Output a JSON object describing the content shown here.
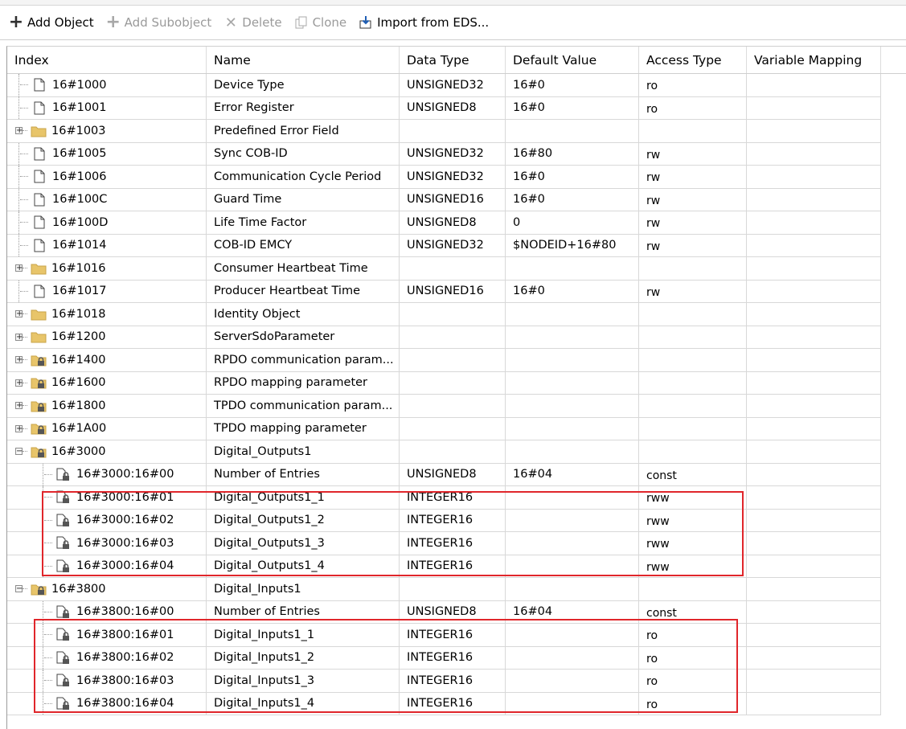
{
  "toolbar": {
    "add_object": "Add Object",
    "add_subobject": "Add Subobject",
    "delete": "Delete",
    "clone": "Clone",
    "import_eds": "Import from EDS..."
  },
  "columns": {
    "index": "Index",
    "name": "Name",
    "data_type": "Data Type",
    "default_value": "Default Value",
    "access_type": "Access Type",
    "variable_mapping": "Variable Mapping"
  },
  "rows": [
    {
      "index": "16#1000",
      "name": "Device Type",
      "type": "UNSIGNED32",
      "def": "16#0",
      "acc": "ro",
      "icon": "file-icon",
      "level": 0,
      "exp": ""
    },
    {
      "index": "16#1001",
      "name": "Error Register",
      "type": "UNSIGNED8",
      "def": "16#0",
      "acc": "ro",
      "icon": "file-icon",
      "level": 0,
      "exp": ""
    },
    {
      "index": "16#1003",
      "name": "Predefined Error Field",
      "type": "",
      "def": "",
      "acc": "",
      "icon": "folder-icon",
      "level": 0,
      "exp": "+"
    },
    {
      "index": "16#1005",
      "name": "Sync COB-ID",
      "type": "UNSIGNED32",
      "def": "16#80",
      "acc": "rw",
      "icon": "file-icon",
      "level": 0,
      "exp": ""
    },
    {
      "index": "16#1006",
      "name": "Communication Cycle Period",
      "type": "UNSIGNED32",
      "def": "16#0",
      "acc": "rw",
      "icon": "file-icon",
      "level": 0,
      "exp": ""
    },
    {
      "index": "16#100C",
      "name": "Guard Time",
      "type": "UNSIGNED16",
      "def": "16#0",
      "acc": "rw",
      "icon": "file-icon",
      "level": 0,
      "exp": ""
    },
    {
      "index": "16#100D",
      "name": "Life Time Factor",
      "type": "UNSIGNED8",
      "def": "0",
      "acc": "rw",
      "icon": "file-icon",
      "level": 0,
      "exp": ""
    },
    {
      "index": "16#1014",
      "name": "COB-ID EMCY",
      "type": "UNSIGNED32",
      "def": "$NODEID+16#80",
      "acc": "rw",
      "icon": "file-icon",
      "level": 0,
      "exp": ""
    },
    {
      "index": "16#1016",
      "name": "Consumer Heartbeat Time",
      "type": "",
      "def": "",
      "acc": "",
      "icon": "folder-icon",
      "level": 0,
      "exp": "+"
    },
    {
      "index": "16#1017",
      "name": "Producer Heartbeat Time",
      "type": "UNSIGNED16",
      "def": "16#0",
      "acc": "rw",
      "icon": "file-icon",
      "level": 0,
      "exp": ""
    },
    {
      "index": "16#1018",
      "name": "Identity Object",
      "type": "",
      "def": "",
      "acc": "",
      "icon": "folder-icon",
      "level": 0,
      "exp": "+"
    },
    {
      "index": "16#1200",
      "name": "ServerSdoParameter",
      "type": "",
      "def": "",
      "acc": "",
      "icon": "folder-icon",
      "level": 0,
      "exp": "+"
    },
    {
      "index": "16#1400",
      "name": "RPDO communication param...",
      "type": "",
      "def": "",
      "acc": "",
      "icon": "locked-folder-icon",
      "level": 0,
      "exp": "+"
    },
    {
      "index": "16#1600",
      "name": "RPDO mapping parameter",
      "type": "",
      "def": "",
      "acc": "",
      "icon": "locked-folder-icon",
      "level": 0,
      "exp": "+"
    },
    {
      "index": "16#1800",
      "name": "TPDO communication param...",
      "type": "",
      "def": "",
      "acc": "",
      "icon": "locked-folder-icon",
      "level": 0,
      "exp": "+"
    },
    {
      "index": "16#1A00",
      "name": "TPDO mapping parameter",
      "type": "",
      "def": "",
      "acc": "",
      "icon": "locked-folder-icon",
      "level": 0,
      "exp": "+"
    },
    {
      "index": "16#3000",
      "name": "Digital_Outputs1",
      "type": "",
      "def": "",
      "acc": "",
      "icon": "locked-folder-icon",
      "level": 0,
      "exp": "-"
    },
    {
      "index": "16#3000:16#00",
      "name": "Number of Entries",
      "type": "UNSIGNED8",
      "def": "16#04",
      "acc": "const",
      "icon": "locked-file-icon",
      "level": 1,
      "exp": ""
    },
    {
      "index": "16#3000:16#01",
      "name": "Digital_Outputs1_1",
      "type": "INTEGER16",
      "def": "",
      "acc": "rww",
      "icon": "locked-file-icon",
      "level": 1,
      "exp": ""
    },
    {
      "index": "16#3000:16#02",
      "name": "Digital_Outputs1_2",
      "type": "INTEGER16",
      "def": "",
      "acc": "rww",
      "icon": "locked-file-icon",
      "level": 1,
      "exp": ""
    },
    {
      "index": "16#3000:16#03",
      "name": "Digital_Outputs1_3",
      "type": "INTEGER16",
      "def": "",
      "acc": "rww",
      "icon": "locked-file-icon",
      "level": 1,
      "exp": ""
    },
    {
      "index": "16#3000:16#04",
      "name": "Digital_Outputs1_4",
      "type": "INTEGER16",
      "def": "",
      "acc": "rww",
      "icon": "locked-file-icon",
      "level": 1,
      "exp": ""
    },
    {
      "index": "16#3800",
      "name": "Digital_Inputs1",
      "type": "",
      "def": "",
      "acc": "",
      "icon": "locked-folder-icon",
      "level": 0,
      "exp": "-"
    },
    {
      "index": "16#3800:16#00",
      "name": "Number of Entries",
      "type": "UNSIGNED8",
      "def": "16#04",
      "acc": "const",
      "icon": "locked-file-icon",
      "level": 1,
      "exp": ""
    },
    {
      "index": "16#3800:16#01",
      "name": "Digital_Inputs1_1",
      "type": "INTEGER16",
      "def": "",
      "acc": "ro",
      "icon": "locked-file-icon",
      "level": 1,
      "exp": ""
    },
    {
      "index": "16#3800:16#02",
      "name": "Digital_Inputs1_2",
      "type": "INTEGER16",
      "def": "",
      "acc": "ro",
      "icon": "locked-file-icon",
      "level": 1,
      "exp": ""
    },
    {
      "index": "16#3800:16#03",
      "name": "Digital_Inputs1_3",
      "type": "INTEGER16",
      "def": "",
      "acc": "ro",
      "icon": "locked-file-icon",
      "level": 1,
      "exp": ""
    },
    {
      "index": "16#3800:16#04",
      "name": "Digital_Inputs1_4",
      "type": "INTEGER16",
      "def": "",
      "acc": "ro",
      "icon": "locked-file-icon",
      "level": 1,
      "exp": ""
    }
  ],
  "colors": {
    "highlight": "#e0262b",
    "folder": "#e8c56a",
    "grid_line": "#d8d8d8"
  }
}
